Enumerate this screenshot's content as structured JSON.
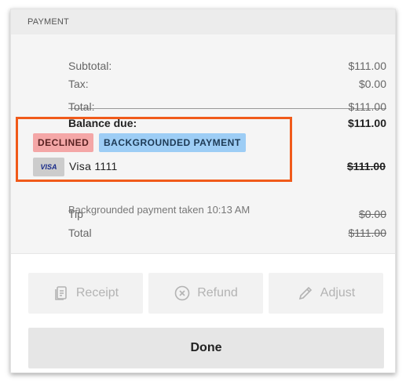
{
  "section": {
    "title": "PAYMENT"
  },
  "summary": {
    "subtotal_label": "Subtotal:",
    "subtotal_value": "$111.00",
    "tax_label": "Tax:",
    "tax_value": "$0.00",
    "total_label": "Total:",
    "total_value": "$111.00",
    "balance_label": "Balance due:",
    "balance_value": "$111.00"
  },
  "payment": {
    "status_badge": "DECLINED",
    "type_badge": "BACKGROUNDED PAYMENT",
    "card_brand": "VISA",
    "card_label": "Visa 1111",
    "amount": "$111.00",
    "note": "Backgrounded payment taken 10:13 AM",
    "tip_label": "Tip",
    "tip_value": "$0.00",
    "total_label": "Total",
    "total_value": "$111.00"
  },
  "actions": {
    "receipt_label": "Receipt",
    "refund_label": "Refund",
    "adjust_label": "Adjust",
    "done_label": "Done"
  },
  "colors": {
    "highlight": "#f05a1a",
    "declined": "#f4a7a7",
    "backgrounded": "#9dcdf5"
  },
  "icons": {
    "receipt": "receipt-icon",
    "refund": "cancel-circle-icon",
    "adjust": "pencil-icon"
  }
}
